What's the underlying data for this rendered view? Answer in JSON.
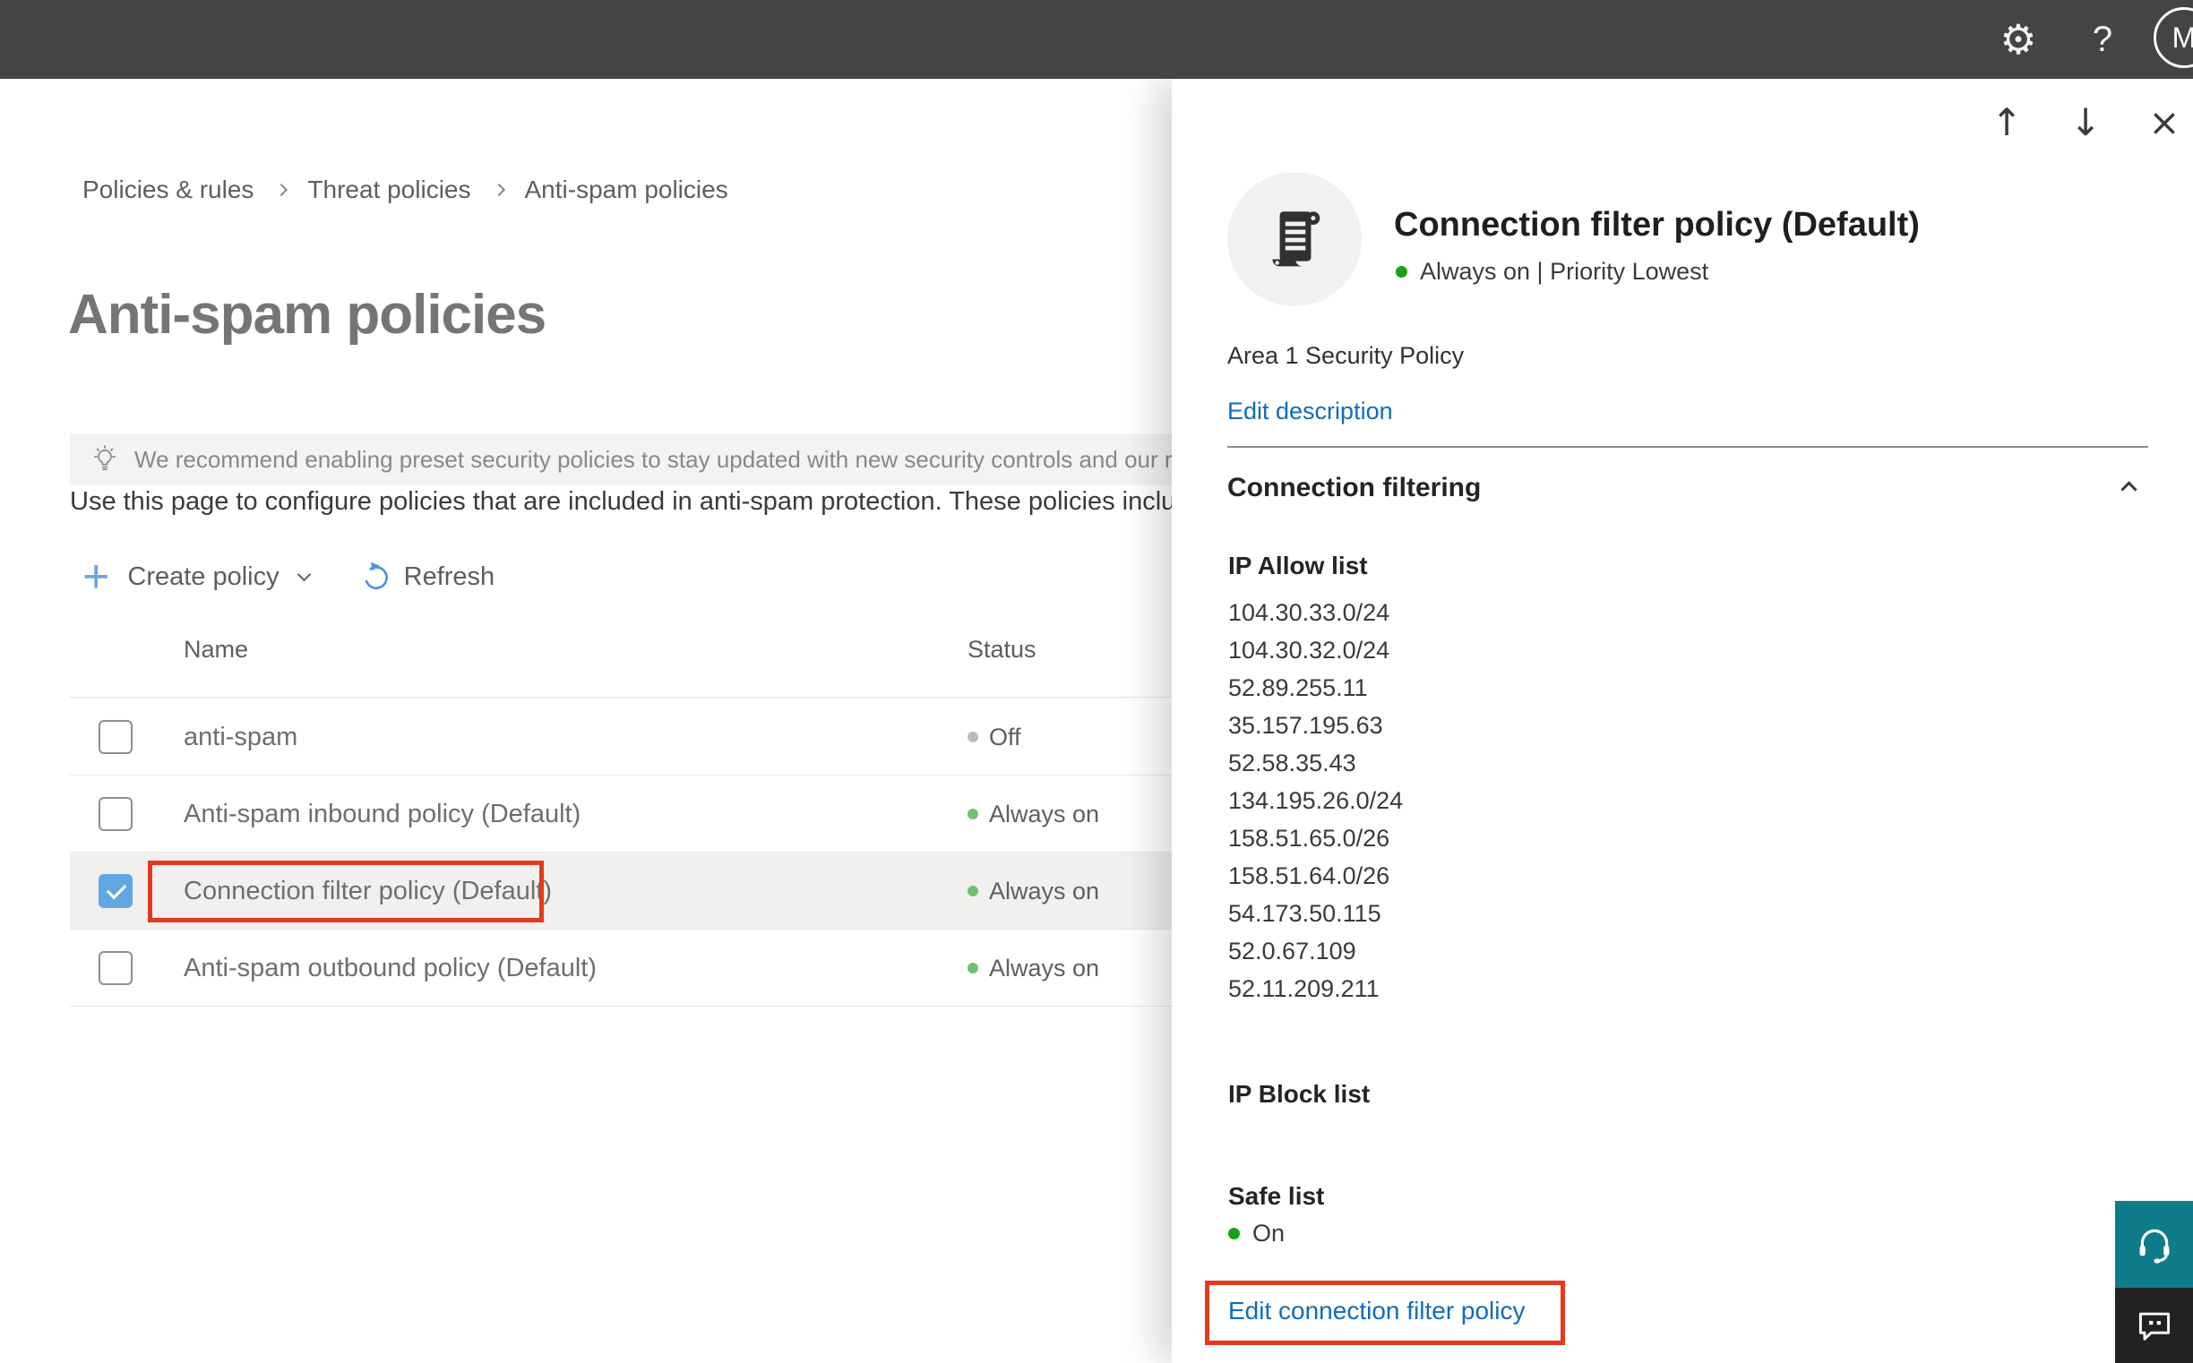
{
  "topbar": {
    "settings_glyph": "⚙",
    "help_glyph": "?",
    "avatar_initial": "M"
  },
  "breadcrumb": {
    "items": [
      "Policies & rules",
      "Threat policies",
      "Anti-spam policies"
    ]
  },
  "main": {
    "title": "Anti-spam policies",
    "banner": "We recommend enabling preset security policies to stay updated with new security controls and our recomme",
    "description": "Use this page to configure policies that are included in anti-spam protection. These policies include",
    "toolbar": {
      "create_policy": "Create policy",
      "refresh": "Refresh"
    },
    "table": {
      "col_name": "Name",
      "col_status": "Status",
      "rows": [
        {
          "name": "anti-spam",
          "status": "Off",
          "checked": false,
          "selected": false,
          "annotated": false
        },
        {
          "name": "Anti-spam inbound policy (Default)",
          "status": "Always on",
          "checked": false,
          "selected": false,
          "annotated": false
        },
        {
          "name": "Connection filter policy (Default)",
          "status": "Always on",
          "checked": true,
          "selected": true,
          "annotated": true
        },
        {
          "name": "Anti-spam outbound policy (Default)",
          "status": "Always on",
          "checked": false,
          "selected": false,
          "annotated": false
        }
      ]
    }
  },
  "flyout": {
    "title": "Connection filter policy (Default)",
    "status": "Always on | Priority Lowest",
    "policy_description": "Area 1 Security Policy",
    "edit_description": "Edit description",
    "section": "Connection filtering",
    "ip_allow_label": "IP Allow list",
    "ip_allow": [
      "104.30.33.0/24",
      "104.30.32.0/24",
      "52.89.255.11",
      "35.157.195.63",
      "52.58.35.43",
      "134.195.26.0/24",
      "158.51.65.0/26",
      "158.51.64.0/26",
      "54.173.50.115",
      "52.0.67.109",
      "52.11.209.211"
    ],
    "ip_block_label": "IP Block list",
    "safe_list_label": "Safe list",
    "safe_list_status": "On",
    "edit_link": "Edit connection filter policy"
  },
  "colors": {
    "topbar_bg": "#454442",
    "accent_blue": "#0f6cbd",
    "annotation_red": "#e4391d",
    "status_green_table": "#72c170",
    "status_green_flyout": "#16a216",
    "status_gray_off": "#bcbab8",
    "checkbox_checked": "#63a7e2",
    "support_teal": "#0f7c8a",
    "feedback_dark": "#242220",
    "selected_row_bg": "#f1f0ef"
  }
}
